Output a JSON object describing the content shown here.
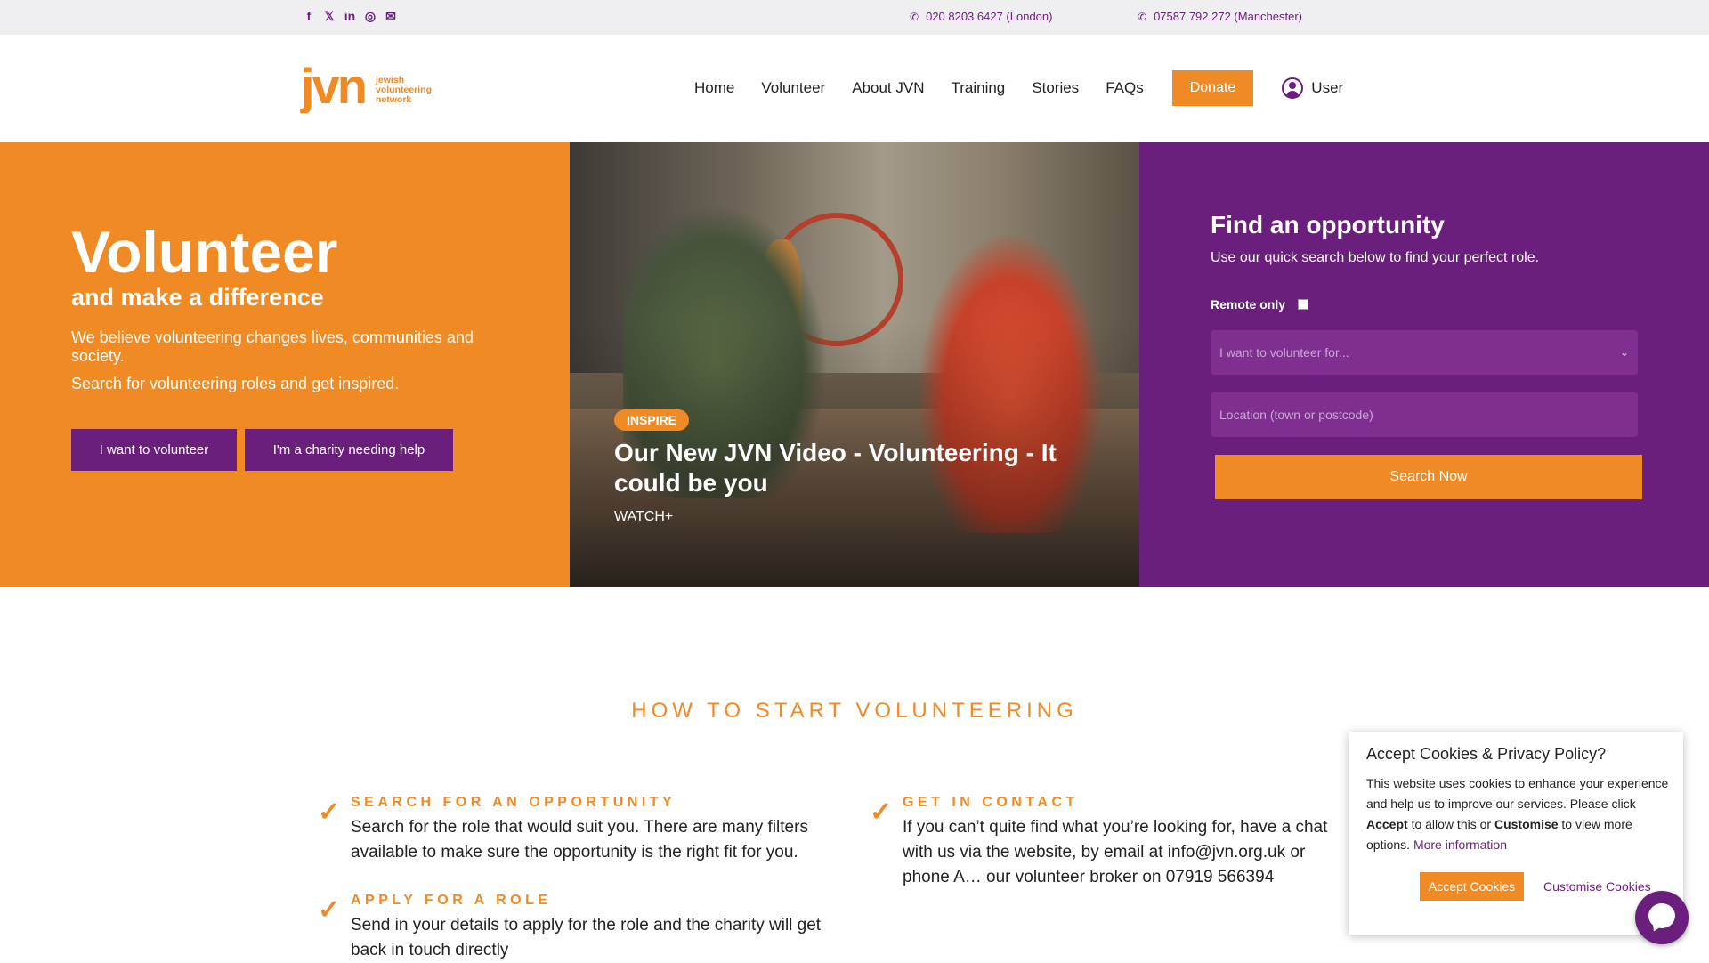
{
  "topbar": {
    "social": [
      "facebook-icon",
      "x-icon",
      "linkedin-icon",
      "instagram-icon",
      "email-icon"
    ],
    "phone_london": "020 8203 6427 (London)",
    "phone_manchester": "07587 792 272 (Manchester)"
  },
  "logo": {
    "mark": "jvn",
    "line1": "jewish",
    "line2": "volunteering",
    "line3": "network"
  },
  "nav": {
    "items": [
      "Home",
      "Volunteer",
      "About JVN",
      "Training",
      "Stories",
      "FAQs"
    ],
    "donate": "Donate",
    "user": "User"
  },
  "hero": {
    "title": "Volunteer",
    "subtitle": "and make a difference",
    "p1": "We believe volunteering changes lives, communities and society.",
    "p2": "Search for volunteering roles and get inspired.",
    "btn_volunteer": "I want to volunteer",
    "btn_charity": "I'm a charity needing help"
  },
  "video": {
    "badge": "INSPIRE",
    "title": "Our New JVN Video - Volunteering - It could be you",
    "watch": "WATCH+"
  },
  "search": {
    "title": "Find an opportunity",
    "subtitle": "Use our quick search below to find your perfect role.",
    "remote_label": "Remote only",
    "remote_checked": false,
    "select_placeholder": "I want to volunteer for...",
    "location_placeholder": "Location (town or postcode)",
    "button": "Search Now"
  },
  "how": {
    "title": "HOW TO START VOLUNTEERING",
    "steps": [
      {
        "title": "SEARCH FOR AN OPPORTUNITY",
        "body": "Search for the role that would suit you. There are many filters available to make sure the opportunity is the right fit for you."
      },
      {
        "title": "APPLY FOR A ROLE",
        "body": "Send in your details to apply for the role and the charity will get back in touch directly"
      },
      {
        "title": "GET IN CONTACT",
        "body": "If you can’t quite find what you’re looking for, have a chat with us via the website, by email at info@jvn.org.uk or phone A… our volunteer broker on 07919 566394"
      }
    ]
  },
  "cookie": {
    "title": "Accept Cookies & Privacy Policy?",
    "text_a": "This website uses cookies to enhance your experience and help us to improve our services. Please click ",
    "accept_word": "Accept",
    "text_b": " to allow this or ",
    "customise_word": "Customise",
    "text_c": " to view more options. ",
    "more": "More information",
    "accept_button": "Accept Cookies",
    "customise_button": "Customise Cookies"
  },
  "colors": {
    "orange": "#f08a24",
    "purple": "#6b1f7c",
    "topbar_bg": "#efeff2"
  }
}
